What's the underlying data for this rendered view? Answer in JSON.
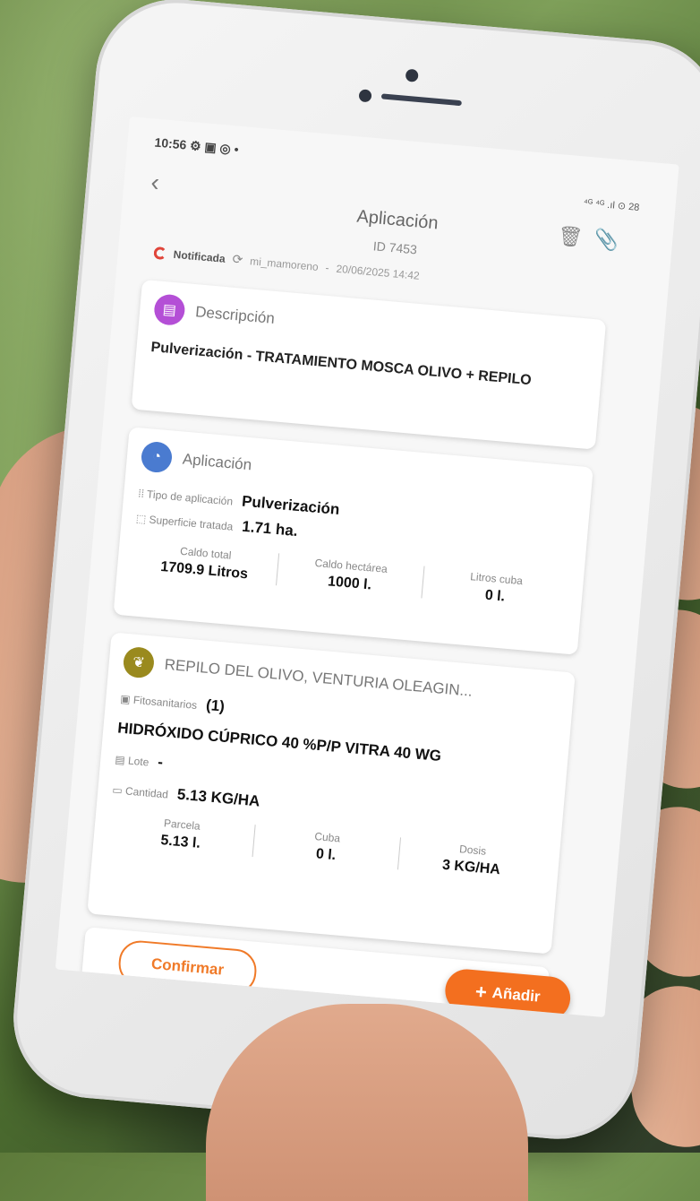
{
  "status_bar": {
    "time": "10:56",
    "icons": "⚙ ▣ ◎ •",
    "right": "⁴ᴳ ⁴ᴳ .ıl  ⊙ 28"
  },
  "header": {
    "title": "Aplicación",
    "id": "ID 7453"
  },
  "record_status": {
    "label": "Notificada",
    "user": "mi_mamoreno",
    "datetime": "20/06/2025 14:42"
  },
  "description_card": {
    "title": "Descripción",
    "text": "Pulverización - TRATAMIENTO MOSCA OLIVO + REPILO",
    "color": "#b44fd6"
  },
  "application_card": {
    "title": "Aplicación",
    "color": "#4a7bd0",
    "type_label": "Tipo de aplicación",
    "type_value": "Pulverización",
    "surface_label": "Superficie tratada",
    "surface_value": "1.71 ha.",
    "stats": [
      {
        "label": "Caldo total",
        "value": "1709.9 Litros"
      },
      {
        "label": "Caldo hectárea",
        "value": "1000 l."
      },
      {
        "label": "Litros cuba",
        "value": "0 l."
      }
    ]
  },
  "treatment_card": {
    "title": "REPILO DEL OLIVO, VENTURIA OLEAGIN...",
    "color": "#9a8a1e",
    "phyto_label": "Fitosanitarios",
    "phyto_count": "(1)",
    "product": "HIDRÓXIDO CÚPRICO 40 %P/P  VITRA 40 WG",
    "lot_label": "Lote",
    "lot_value": "-",
    "qty_label": "Cantidad",
    "qty_value": "5.13 KG/HA",
    "stats": [
      {
        "label": "Parcela",
        "value": "5.13 l."
      },
      {
        "label": "Cuba",
        "value": "0 l."
      },
      {
        "label": "Dosis",
        "value": "3 KG/HA"
      }
    ]
  },
  "actions": {
    "confirm": "Confirmar",
    "add": "Añadir"
  }
}
